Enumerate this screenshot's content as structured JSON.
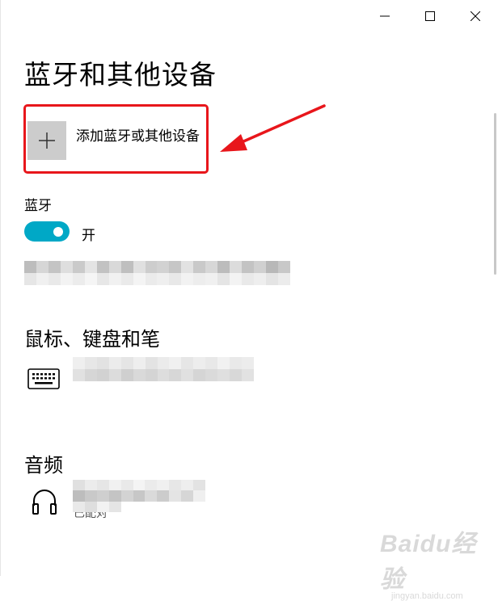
{
  "window": {
    "controls": [
      {
        "name": "minimize-button",
        "icon": "minimize-icon"
      },
      {
        "name": "maximize-button",
        "icon": "maximize-icon"
      },
      {
        "name": "close-button",
        "icon": "close-icon"
      }
    ]
  },
  "page": {
    "title": "蓝牙和其他设备"
  },
  "add_device": {
    "label": "添加蓝牙或其他设备",
    "icon": "plus-icon"
  },
  "bluetooth": {
    "label": "蓝牙",
    "toggle_state": "开",
    "is_on": true
  },
  "sections": {
    "input": {
      "heading": "鼠标、键盘和笔",
      "device_icon": "keyboard-icon"
    },
    "audio": {
      "heading": "音频",
      "device_icon": "headphones-icon",
      "device_status": "已配对"
    }
  },
  "watermark": {
    "brand": "Baidu经验",
    "url": "jingyan.baidu.com"
  },
  "colors": {
    "toggle_on": "#00a8c6",
    "highlight": "#e8161b",
    "add_tile": "#cccccc"
  }
}
